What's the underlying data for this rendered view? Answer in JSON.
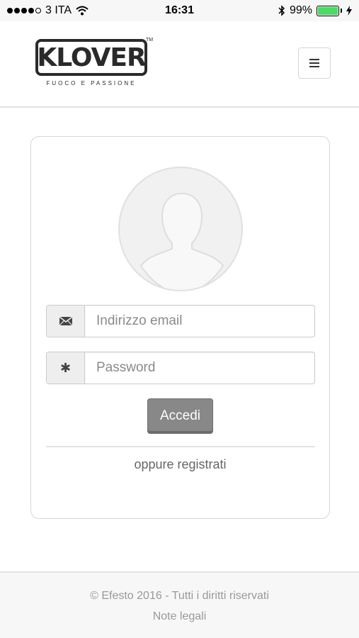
{
  "status_bar": {
    "carrier": "3 ITA",
    "time": "16:31",
    "battery_percent": "99%",
    "battery_level": 0.99,
    "signal_bars_filled": 4,
    "signal_bars_total": 5,
    "icons": [
      "signal-dots-icon",
      "wifi-icon",
      "bluetooth-icon",
      "battery-icon",
      "charging-icon"
    ]
  },
  "header": {
    "logo_text": "KLOVER",
    "logo_tagline": "FUOCO E PASSIONE",
    "logo_tm": "TM",
    "menu_icon": "hamburger-icon"
  },
  "login": {
    "avatar_icon": "user-silhouette-icon",
    "email": {
      "icon": "envelope-icon",
      "placeholder": "Indirizzo email",
      "value": ""
    },
    "password": {
      "icon": "asterisk-icon",
      "placeholder": "Password",
      "value": ""
    },
    "submit_label": "Accedi",
    "register_link": "oppure registrati"
  },
  "footer": {
    "copyright": "© Efesto 2016 - Tutti i diritti riservati",
    "legal_link": "Note legali"
  },
  "colors": {
    "accent_button": "#888888",
    "battery_green": "#4cd964",
    "border": "#d7d7d7"
  }
}
